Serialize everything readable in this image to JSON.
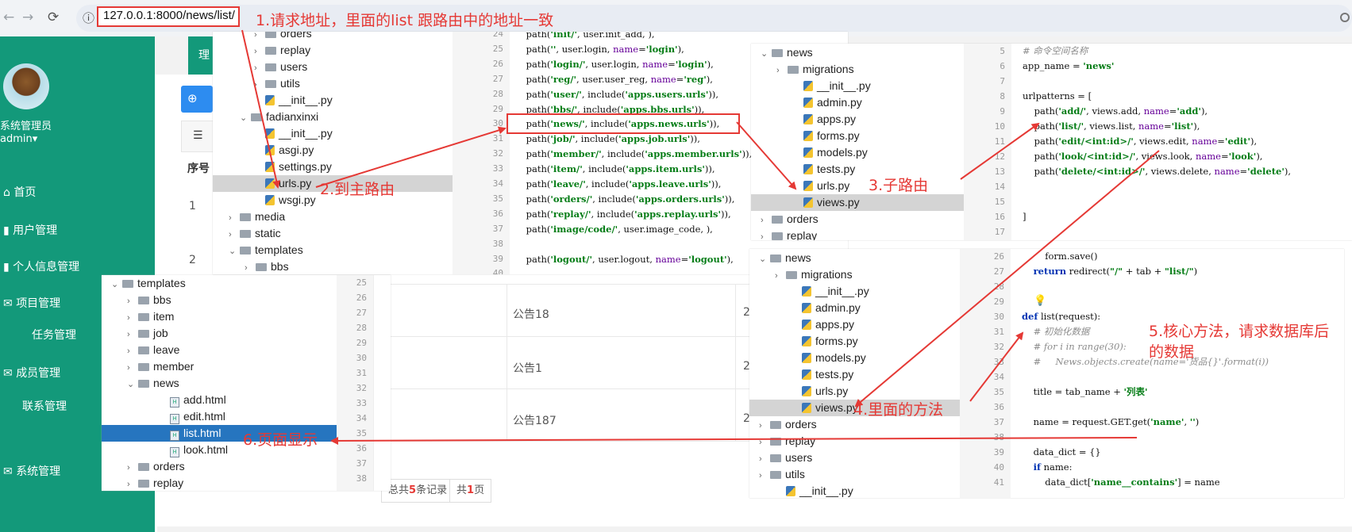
{
  "browser": {
    "back": "←",
    "forward": "→",
    "reload": "⟳",
    "info": "ⓘ",
    "url": "127.0.0.1:8000/news/list/"
  },
  "annotations": {
    "a1": "1.请求地址，里面的list 跟路由中的地址一致",
    "a2": "2.到主路由",
    "a3": "3.子路由",
    "a4": "4.里面的方法",
    "a5_line1": "5.核心方法，请求数据库后",
    "a5_line2": "的数据",
    "a6": "6.页面显示"
  },
  "app": {
    "role": "系统管理员",
    "user": "admin",
    "tab": "理",
    "menu": [
      "首页",
      "用户管理",
      "个人信息管理",
      "项目管理",
      "任务管理",
      "成员管理",
      "联系管理",
      "系统管理"
    ],
    "table_header": "序号",
    "rows": [
      {
        "index": "1",
        "title": "公告18",
        "date": "2"
      },
      {
        "index": "2",
        "title": "公告1",
        "date": "2"
      },
      {
        "index": "",
        "title": "公告187",
        "date": "2"
      }
    ],
    "pager": {
      "total_label_pre": "总共",
      "total_count": "5",
      "total_label_post": "条记录",
      "pages_pre": "共",
      "pages": "1",
      "pages_post": "页"
    }
  },
  "panel_main_urls": {
    "tree": [
      {
        "label": "orders",
        "type": "folder"
      },
      {
        "label": "replay",
        "type": "folder"
      },
      {
        "label": "users",
        "type": "folder"
      },
      {
        "label": "utils",
        "type": "folder"
      },
      {
        "label": "__init__.py",
        "type": "py"
      },
      {
        "label": "fadianxinxi",
        "type": "folder"
      },
      {
        "label": "__init__.py",
        "type": "py"
      },
      {
        "label": "asgi.py",
        "type": "py"
      },
      {
        "label": "settings.py",
        "type": "py"
      },
      {
        "label": "urls.py",
        "type": "py"
      },
      {
        "label": "wsgi.py",
        "type": "py"
      },
      {
        "label": "media",
        "type": "folder"
      },
      {
        "label": "static",
        "type": "folder"
      },
      {
        "label": "templates",
        "type": "folder"
      },
      {
        "label": "bbs",
        "type": "folder"
      }
    ],
    "line_numbers": [
      "24",
      "25",
      "26",
      "27",
      "28",
      "29",
      "30",
      "31",
      "32",
      "33",
      "34",
      "35",
      "36",
      "37",
      "38",
      "39",
      "40"
    ],
    "code": [
      "    path('init/', user.init_add, ),",
      "    path('', user.login, name='login'),",
      "    path('login/', user.login, name='login'),",
      "    path('reg/', user.user_reg, name='reg'),",
      "    path('user/', include('apps.users.urls')),",
      "    path('bbs/', include('apps.bbs.urls')),",
      "    path('news/', include('apps.news.urls')),",
      "    path('job/', include('apps.job.urls')),",
      "    path('member/', include('apps.member.urls')),",
      "    path('item/', include('apps.item.urls')),",
      "    path('leave/', include('apps.leave.urls')),",
      "    path('orders/', include('apps.orders.urls')),",
      "    path('replay/', include('apps.replay.urls')),",
      "    path('image/code/', user.image_code, ),",
      "",
      "    path('logout/', user.logout, name='logout'),",
      ""
    ]
  },
  "panel_sub_urls": {
    "tree": [
      {
        "label": "news",
        "type": "folder"
      },
      {
        "label": "migrations",
        "type": "folder"
      },
      {
        "label": "__init__.py",
        "type": "py"
      },
      {
        "label": "admin.py",
        "type": "py"
      },
      {
        "label": "apps.py",
        "type": "py"
      },
      {
        "label": "forms.py",
        "type": "py"
      },
      {
        "label": "models.py",
        "type": "py"
      },
      {
        "label": "tests.py",
        "type": "py"
      },
      {
        "label": "urls.py",
        "type": "py"
      },
      {
        "label": "views.py",
        "type": "py"
      },
      {
        "label": "orders",
        "type": "folder"
      },
      {
        "label": "replay",
        "type": "folder"
      }
    ],
    "line_numbers": [
      "5",
      "6",
      "7",
      "8",
      "9",
      "10",
      "11",
      "12",
      "13",
      "14",
      "15",
      "16",
      "17"
    ],
    "code": [
      "# 命令空间名称",
      "app_name = 'news'",
      "",
      "urlpatterns = [",
      "    path('add/', views.add, name='add'),",
      "    path('list/', views.list, name='list'),",
      "    path('edit/<int:id>/', views.edit, name='edit'),",
      "    path('look/<int:id>/', views.look, name='look'),",
      "    path('delete/<int:id>/', views.delete, name='delete'),",
      "",
      "",
      "]",
      ""
    ]
  },
  "panel_views": {
    "tree": [
      {
        "label": "news",
        "type": "folder"
      },
      {
        "label": "migrations",
        "type": "folder"
      },
      {
        "label": "__init__.py",
        "type": "py"
      },
      {
        "label": "admin.py",
        "type": "py"
      },
      {
        "label": "apps.py",
        "type": "py"
      },
      {
        "label": "forms.py",
        "type": "py"
      },
      {
        "label": "models.py",
        "type": "py"
      },
      {
        "label": "tests.py",
        "type": "py"
      },
      {
        "label": "urls.py",
        "type": "py"
      },
      {
        "label": "views.py",
        "type": "py"
      },
      {
        "label": "orders",
        "type": "folder"
      },
      {
        "label": "replay",
        "type": "folder"
      },
      {
        "label": "users",
        "type": "folder"
      },
      {
        "label": "utils",
        "type": "folder"
      },
      {
        "label": "__init__.py",
        "type": "py"
      }
    ],
    "line_numbers": [
      "26",
      "27",
      "28",
      "29",
      "30",
      "31",
      "32",
      "33",
      "34",
      "35",
      "36",
      "37",
      "38",
      "39",
      "40",
      "41"
    ],
    "code": [
      "        form.save()",
      "    return redirect(\"/\" + tab + \"list/\")",
      "",
      "",
      "def list(request):",
      "    # 初始化数据",
      "    # for i in range(30):",
      "    #     News.objects.create(name='货品{}'.format(i))",
      "",
      "    title = tab_name + '列表'",
      "",
      "    name = request.GET.get('name', '')",
      "",
      "    data_dict = {}",
      "    if name:",
      "        data_dict['name__contains'] = name"
    ]
  },
  "panel_templates": {
    "tree": [
      {
        "label": "templates",
        "type": "folder"
      },
      {
        "label": "bbs",
        "type": "folder"
      },
      {
        "label": "item",
        "type": "folder"
      },
      {
        "label": "job",
        "type": "folder"
      },
      {
        "label": "leave",
        "type": "folder"
      },
      {
        "label": "member",
        "type": "folder"
      },
      {
        "label": "news",
        "type": "folder"
      },
      {
        "label": "add.html",
        "type": "html"
      },
      {
        "label": "edit.html",
        "type": "html"
      },
      {
        "label": "list.html",
        "type": "html"
      },
      {
        "label": "look.html",
        "type": "html"
      },
      {
        "label": "orders",
        "type": "folder"
      },
      {
        "label": "replay",
        "type": "folder"
      }
    ],
    "line_numbers": [
      "25",
      "26",
      "27",
      "28",
      "29",
      "30",
      "31",
      "32",
      "33",
      "34",
      "35",
      "36",
      "37",
      "38"
    ]
  },
  "colors": {
    "accent_red": "#e53935",
    "sidebar_green": "#13997a",
    "selection_blue": "#2675bf"
  }
}
